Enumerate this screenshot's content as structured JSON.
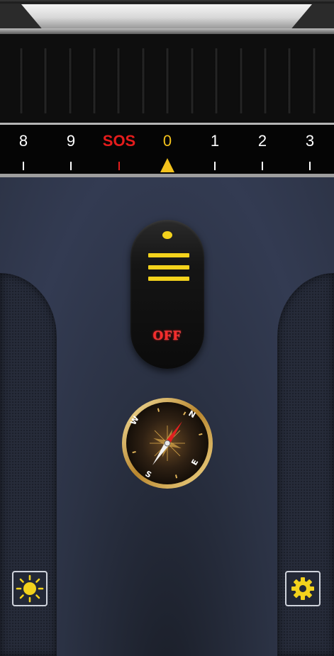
{
  "dial": {
    "labels": [
      "8",
      "9",
      "SOS",
      "0",
      "1",
      "2",
      "3"
    ],
    "selected": "0"
  },
  "switch": {
    "state_label": "OFF"
  },
  "compass": {
    "directions": [
      "N",
      "E",
      "S",
      "W"
    ]
  },
  "buttons": {
    "brightness": "brightness-icon",
    "settings": "gear-icon"
  },
  "colors": {
    "accent": "#f3c21c",
    "sos": "#e51c1c",
    "off": "#ff2a2a"
  }
}
